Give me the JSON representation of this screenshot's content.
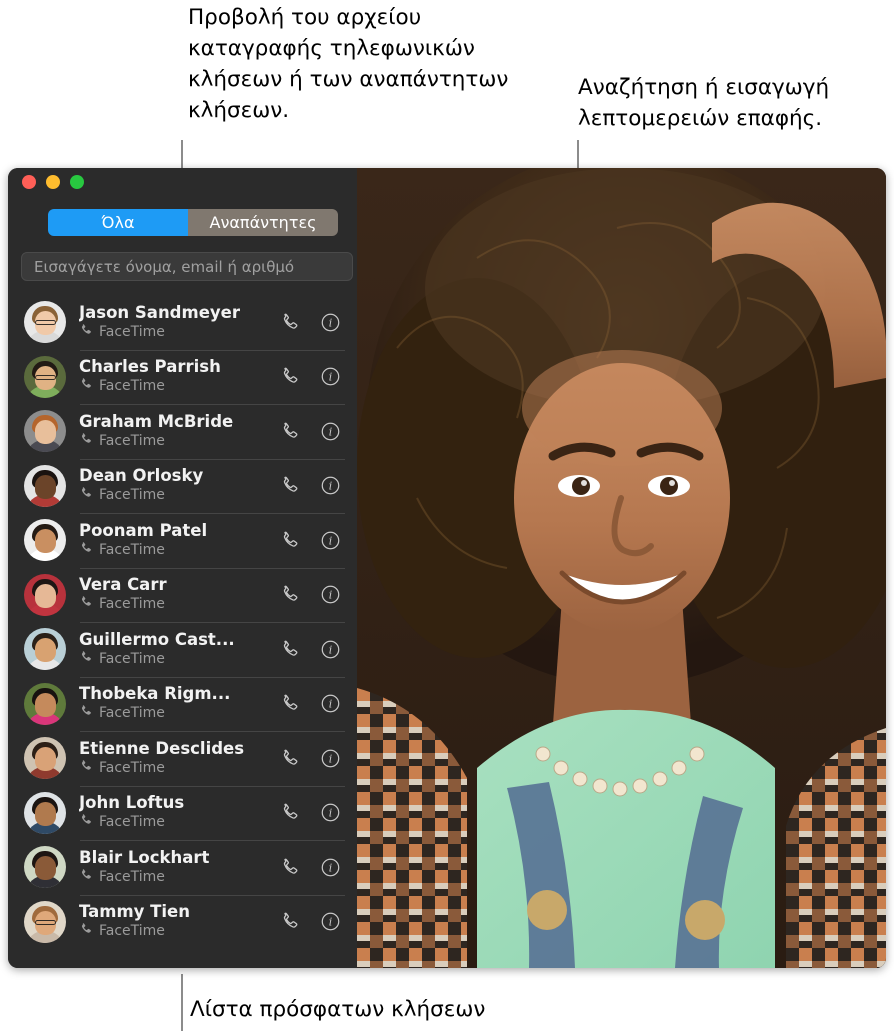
{
  "annotations": {
    "top_left": "Προβολή του αρχείου καταγραφής τηλεφωνικών κλήσεων ή των αναπάντητων κλήσεων.",
    "top_right": "Αναζήτηση ή εισαγωγή λεπτομερειών επαφής.",
    "bottom": "Λίστα πρόσφατων κλήσεων"
  },
  "window": {
    "traffic_lights": {
      "close": "close-button",
      "minimize": "minimize-button",
      "zoom": "zoom-button"
    },
    "segmented_control": {
      "selected_index": 0,
      "options": [
        {
          "label": "Όλα",
          "selected": true
        },
        {
          "label": "Αναπάντητες",
          "selected": false
        }
      ]
    },
    "search": {
      "value": "",
      "placeholder": "Εισαγάγετε όνομα, email ή αριθμό"
    },
    "contacts": [
      {
        "name": "Jason Sandmeyer",
        "service": "FaceTime",
        "skin": "#f0c9a8",
        "hair": "#8a6237",
        "shirt": "#d9d9d9",
        "bg": "#e8e8e8",
        "glasses": true
      },
      {
        "name": "Charles Parrish",
        "service": "FaceTime",
        "skin": "#e0b284",
        "hair": "#221a14",
        "shirt": "#7fae5c",
        "bg": "#5a6a3c",
        "glasses": true
      },
      {
        "name": "Graham McBride",
        "service": "FaceTime",
        "skin": "#e8bf9b",
        "hair": "#b5652c",
        "shirt": "#4a4a52",
        "bg": "#8d8d8d",
        "glasses": false
      },
      {
        "name": "Dean Orlosky",
        "service": "FaceTime",
        "skin": "#6b4429",
        "hair": "#1a1310",
        "shirt": "#b23b36",
        "bg": "#e4e4e4",
        "glasses": false
      },
      {
        "name": "Poonam Patel",
        "service": "FaceTime",
        "skin": "#c98f61",
        "hair": "#241a14",
        "shirt": "#ffffff",
        "bg": "#ededed",
        "glasses": false
      },
      {
        "name": "Vera Carr",
        "service": "FaceTime",
        "skin": "#e6b896",
        "hair": "#1e1614",
        "shirt": "#c1343f",
        "bg": "#b8323c",
        "glasses": false
      },
      {
        "name": "Guillermo Cast...",
        "service": "FaceTime",
        "skin": "#d8a271",
        "hair": "#2a2018",
        "shirt": "#e8e8e8",
        "bg": "#b9cfd6",
        "glasses": false
      },
      {
        "name": "Thobeka Rigm...",
        "service": "FaceTime",
        "skin": "#c58a5c",
        "hair": "#181210",
        "shirt": "#d9367a",
        "bg": "#5f7a3b",
        "glasses": false
      },
      {
        "name": "Etienne Desclides",
        "service": "FaceTime",
        "skin": "#d9a277",
        "hair": "#2c1f16",
        "shirt": "#8f3a2e",
        "bg": "#cfc3b2",
        "glasses": false
      },
      {
        "name": "John Loftus",
        "service": "FaceTime",
        "skin": "#b07a4e",
        "hair": "#1b1411",
        "shirt": "#2f4a66",
        "bg": "#dfe3e6",
        "glasses": false
      },
      {
        "name": "Blair Lockhart",
        "service": "FaceTime",
        "skin": "#8a5a38",
        "hair": "#1d1512",
        "shirt": "#2f2f35",
        "bg": "#cfd8c4",
        "glasses": false
      },
      {
        "name": "Tammy Tien",
        "service": "FaceTime",
        "skin": "#dfa87a",
        "hair": "#a06a3c",
        "shirt": "#c9b9a8",
        "bg": "#e0d7c8",
        "glasses": true
      }
    ],
    "row_actions": {
      "call_label": "audio-call",
      "info_label": "contact-info"
    }
  },
  "colors": {
    "accent_blue": "#1e9bf5",
    "segment_gray": "#80786f",
    "window_bg": "#2b2b2b",
    "leader_line": "#8c8c8c"
  }
}
